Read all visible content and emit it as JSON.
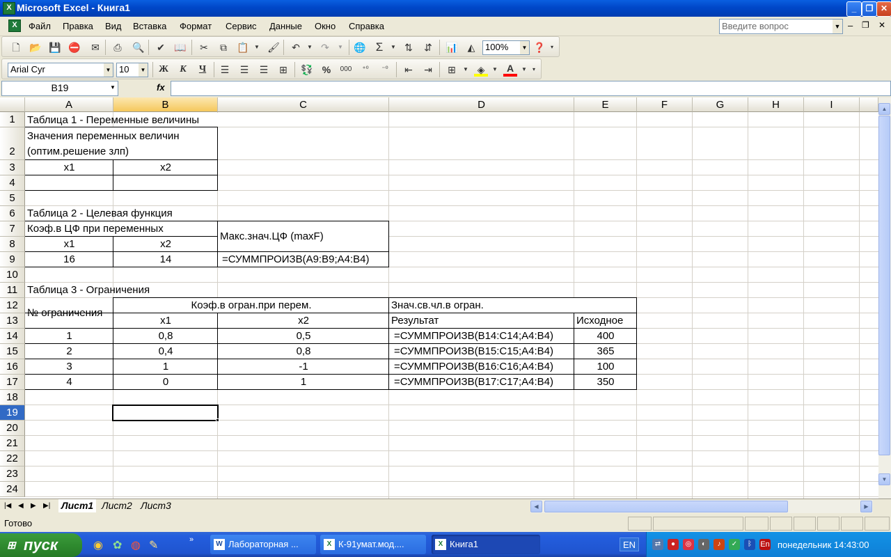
{
  "window": {
    "title": "Microsoft Excel - Книга1"
  },
  "menu": [
    "Файл",
    "Правка",
    "Вид",
    "Вставка",
    "Формат",
    "Сервис",
    "Данные",
    "Окно",
    "Справка"
  ],
  "help_placeholder": "Введите вопрос",
  "toolbar": {
    "zoom": "100%",
    "font_name": "Arial Cyr",
    "font_size": "10",
    "bold": "Ж",
    "italic": "К",
    "underline": "Ч"
  },
  "formula_bar": {
    "name_box": "B19",
    "fx": "fx",
    "formula": ""
  },
  "columns": [
    "A",
    "B",
    "C",
    "D",
    "E",
    "F",
    "G",
    "H",
    "I"
  ],
  "rows": [
    "1",
    "2",
    "3",
    "4",
    "5",
    "6",
    "7",
    "8",
    "9",
    "10",
    "11",
    "12",
    "13",
    "14",
    "15",
    "16",
    "17",
    "18",
    "19",
    "20",
    "21",
    "22",
    "23",
    "24"
  ],
  "cells": {
    "A1": "Таблица 1 - Переменные величины",
    "A2a": "Значения переменных величин",
    "A2b": "(оптим.решение злп)",
    "A3": "x1",
    "B3": "x2",
    "A6": "Таблица 2 - Целевая функция",
    "A7": "Коэф.в ЦФ при переменных",
    "C7": "Макс.знач.ЦФ (maxF)",
    "A8": "x1",
    "B8": "x2",
    "A9": "16",
    "B9": "14",
    "C9": "=СУММПРОИЗВ(A9:B9;A4:B4)",
    "A11": "Таблица 3 - Ограничения",
    "A12": "№ ограничения",
    "B12": "Коэф.в огран.при перем.",
    "D12": "Знач.св.чл.в огран.",
    "B13": "x1",
    "C13": "x2",
    "D13": "Результат",
    "E13": "Исходное",
    "A14": "1",
    "B14": "0,8",
    "C14": "0,5",
    "D14": "=СУММПРОИЗВ(B14:C14;A4:B4)",
    "E14": "400",
    "A15": "2",
    "B15": "0,4",
    "C15": "0,8",
    "D15": "=СУММПРОИЗВ(B15:C15;A4:B4)",
    "E15": "365",
    "A16": "3",
    "B16": "1",
    "C16": "-1",
    "D16": "=СУММПРОИЗВ(B16:C16;A4:B4)",
    "E16": "100",
    "A17": "4",
    "B17": "0",
    "C17": "1",
    "D17": "=СУММПРОИЗВ(B17:C17;A4:B4)",
    "E17": "350"
  },
  "sheets": [
    "Лист1",
    "Лист2",
    "Лист3"
  ],
  "status": "Готово",
  "taskbar": {
    "start": "пуск",
    "tasks": [
      "Лабораторная ...",
      "К-91умат.мод....",
      "Книга1"
    ],
    "lang": "EN",
    "tray_lang": "En",
    "clock": "понедельник 14:43:00"
  }
}
